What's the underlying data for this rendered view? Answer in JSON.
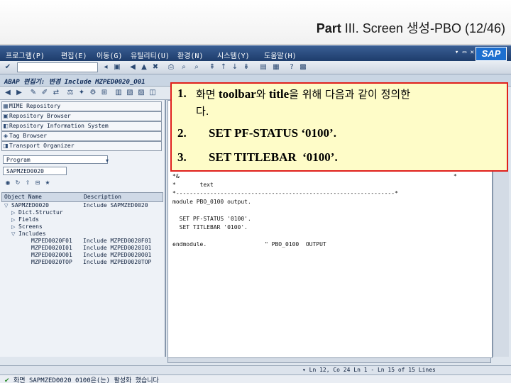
{
  "slide": {
    "title_part": "Part",
    "title_rest": "III. Screen 생성-PBO (12/46)"
  },
  "sap": {
    "menu": [
      "프로그램(P)",
      "편집(E)",
      "이동(G)",
      "유틸리티(U)",
      "환경(N)",
      "시스템(Y)",
      "도움말(H)"
    ],
    "window_controls": "▾ ▭ ✕",
    "logo": "SAP",
    "title_bar": "ABAP 편집기: 변경 Include MZPED0020_O01",
    "icons": {
      "enter": "check-icon",
      "save": "save-icon",
      "back": "back-icon",
      "exit": "exit-icon",
      "cancel": "cancel-icon",
      "print": "print-icon",
      "find": "find-icon",
      "help": "help-icon"
    },
    "repository_buttons": [
      "MIME Repository",
      "Repository Browser",
      "Repository Information System",
      "Tag Browser",
      "Transport Organizer"
    ],
    "object_type": "Program",
    "object_name": "SAPMZED0020",
    "tree_headers": [
      "Object Name",
      "Description"
    ],
    "tree": [
      {
        "name": "SAPMZED0020",
        "desc": "Include SAPMZED0020",
        "indent": 1,
        "toggle": "▽"
      },
      {
        "name": "Dict.Structur",
        "desc": "",
        "indent": 2,
        "toggle": "▷"
      },
      {
        "name": "Fields",
        "desc": "",
        "indent": 2,
        "toggle": "▷"
      },
      {
        "name": "Screens",
        "desc": "",
        "indent": 2,
        "toggle": "▷"
      },
      {
        "name": "Includes",
        "desc": "",
        "indent": 2,
        "toggle": "▽"
      },
      {
        "name": "MZPED0020F01",
        "desc": "Include MZPED0020F01",
        "indent": 3,
        "toggle": ""
      },
      {
        "name": "MZPED0020I01",
        "desc": "Include MZPED0020I01",
        "indent": 3,
        "toggle": ""
      },
      {
        "name": "MZPED0020O01",
        "desc": "Include MZPED0020O01",
        "indent": 3,
        "toggle": ""
      },
      {
        "name": "MZPED0020TOP",
        "desc": "Include MZPED0020TOP",
        "indent": 3,
        "toggle": ""
      }
    ],
    "code": [
      "*&",
      "*       text",
      "*----------------------------------------------------------------*",
      "module PBO_0100 output.",
      "",
      "  SET PF-STATUS '0100'.",
      "  SET TITLEBAR '0100'.",
      "",
      "endmodule.                 \" PBO_0100  OUTPUT"
    ],
    "code_right_mark": "*",
    "status_position": "▾ Ln 12, Co 24        Ln 1 - Ln 15 of 15 Lines",
    "message": "화면 SAPMZED0020 0100은(는) 활성화 했습니다"
  },
  "callout": {
    "items": [
      {
        "num": "1.",
        "text_ko_1": "화면",
        "text_en_1": " toolbar",
        "text_ko_2": "와",
        "text_en_2": " title",
        "text_ko_3": "을 위해 다음과 같이 정의한",
        "line2": "다."
      },
      {
        "num": "2.",
        "text": "SET PF-STATUS ‘0100’."
      },
      {
        "num": "3.",
        "text": "SET TITLEBAR  ‘0100’."
      }
    ]
  }
}
